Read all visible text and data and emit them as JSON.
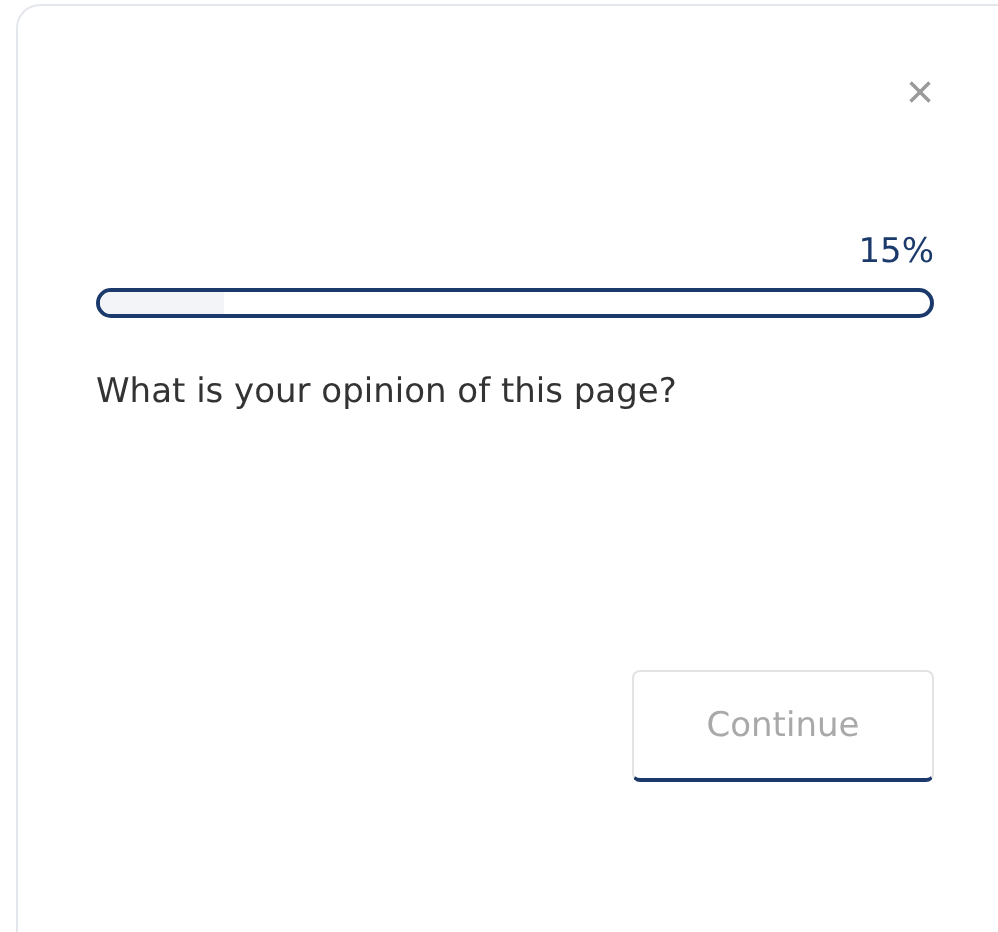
{
  "dialog": {
    "close_label": "×",
    "progress": {
      "reading": "15%",
      "level": 0.15
    },
    "question": "What is your opinion of this page?",
    "continue_button": {
      "label": "Continue",
      "disabled": true
    }
  }
}
